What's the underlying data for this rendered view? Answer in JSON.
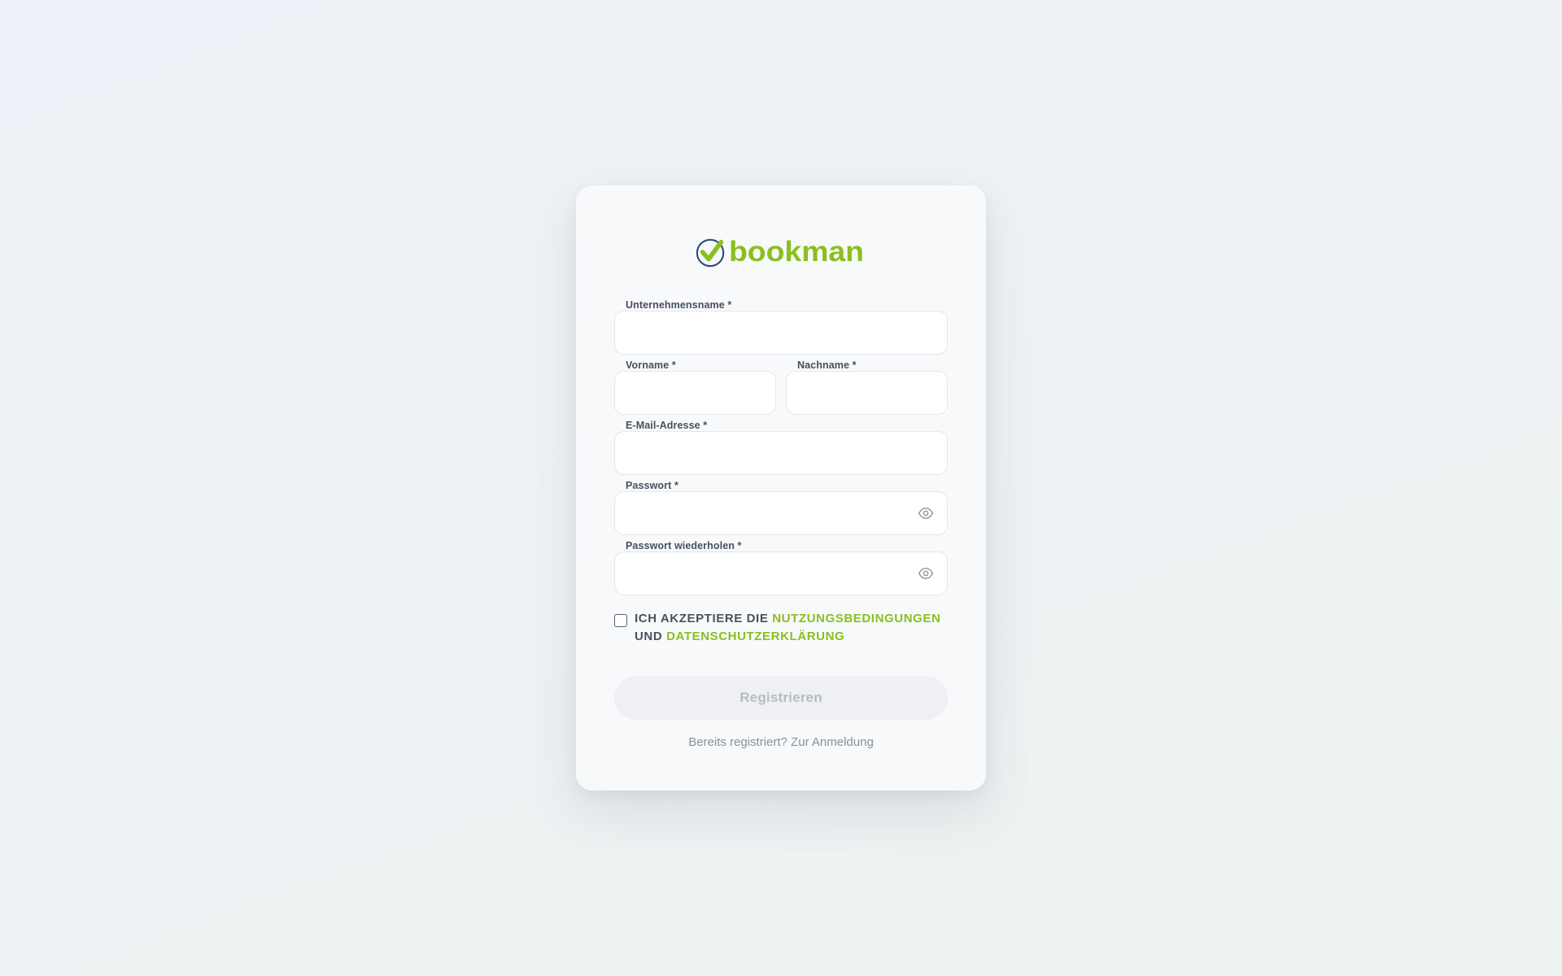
{
  "brand": {
    "name": "bookman",
    "accent_color": "#8abf1f",
    "mark_ring_color": "#2e4a74",
    "logo_icon": "check-circle-icon"
  },
  "form": {
    "company": {
      "label": "Unternehmensname *",
      "value": "",
      "placeholder": ""
    },
    "first_name": {
      "label": "Vorname *",
      "value": "",
      "placeholder": ""
    },
    "last_name": {
      "label": "Nachname *",
      "value": "",
      "placeholder": ""
    },
    "email": {
      "label": "E-Mail-Adresse *",
      "value": "",
      "placeholder": ""
    },
    "password": {
      "label": "Passwort *",
      "value": "",
      "placeholder": "",
      "toggle_icon": "eye-icon"
    },
    "password_repeat": {
      "label": "Passwort wiederholen *",
      "value": "",
      "placeholder": "",
      "toggle_icon": "eye-icon"
    }
  },
  "terms": {
    "checked": false,
    "text_prefix": "ICH AKZEPTIERE DIE ",
    "terms_link": "NUTZUNGSBEDINGUNGEN",
    "text_middle": " UND ",
    "privacy_link": "DATENSCHUTZERKLÄRUNG"
  },
  "submit": {
    "label": "Registrieren",
    "disabled": true
  },
  "login_prompt": "Bereits registriert? Zur Anmeldung"
}
